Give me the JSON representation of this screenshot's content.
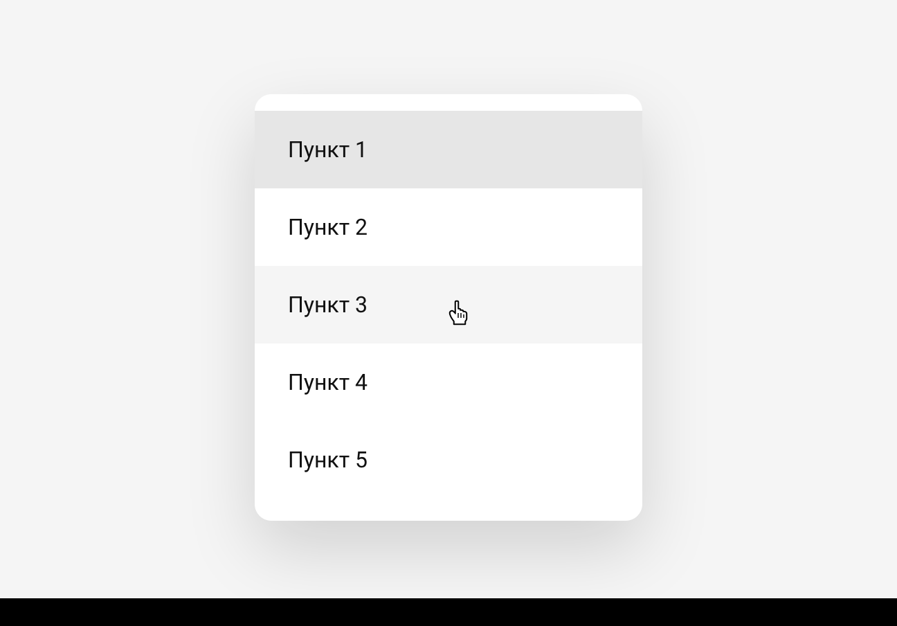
{
  "list": {
    "items": [
      {
        "label": "Пункт 1",
        "state": "selected"
      },
      {
        "label": "Пункт 2",
        "state": "normal"
      },
      {
        "label": "Пункт 3",
        "state": "hovered"
      },
      {
        "label": "Пункт 4",
        "state": "normal"
      },
      {
        "label": "Пункт 5",
        "state": "normal"
      }
    ]
  }
}
